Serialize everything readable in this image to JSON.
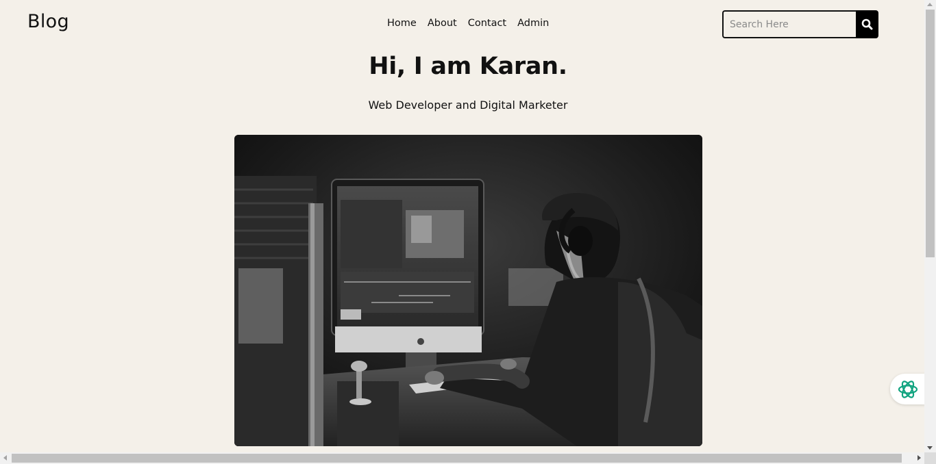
{
  "header": {
    "logo": "Blog",
    "nav": [
      "Home",
      "About",
      "Contact",
      "Admin"
    ],
    "search": {
      "placeholder": "Search Here",
      "value": "",
      "button_icon": "search-icon"
    }
  },
  "hero": {
    "title": "Hi, I am Karan.",
    "subtitle": "Web Developer and Digital Marketer",
    "image": "person-editing-video-at-computer-photo"
  },
  "assistant": {
    "icon": "assistant-logo-icon",
    "color": "#10a37f"
  },
  "colors": {
    "background": "#f4f0e9",
    "text": "#111111",
    "button": "#000000"
  }
}
